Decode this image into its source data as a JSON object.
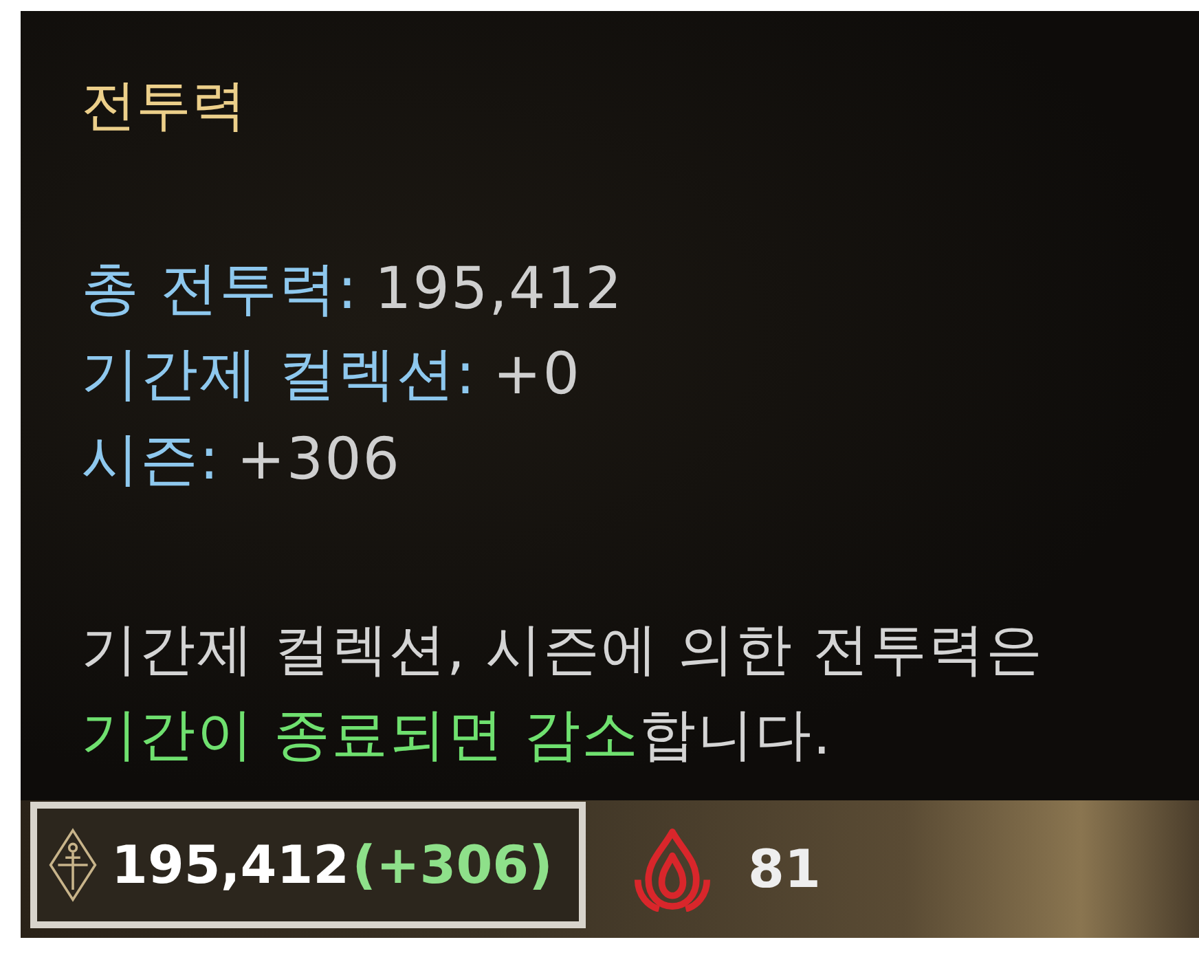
{
  "tooltip": {
    "title": "전투력",
    "stats": [
      {
        "label": "총 전투력:",
        "value": "195,412"
      },
      {
        "label": "기간제 컬렉션:",
        "value": "+0"
      },
      {
        "label": "시즌:",
        "value": "+306"
      }
    ],
    "note": [
      {
        "text": "기간제 컬렉션, 시즌에 의한 전투력은 ",
        "highlight": false
      },
      {
        "text": "기간이 종료되면 감소",
        "highlight": true
      },
      {
        "text": "합니다.",
        "highlight": false
      }
    ]
  },
  "status_bar": {
    "power": {
      "value": "195,412",
      "bonus": "(+306)",
      "selected": true
    },
    "flame": {
      "value": "81"
    }
  }
}
